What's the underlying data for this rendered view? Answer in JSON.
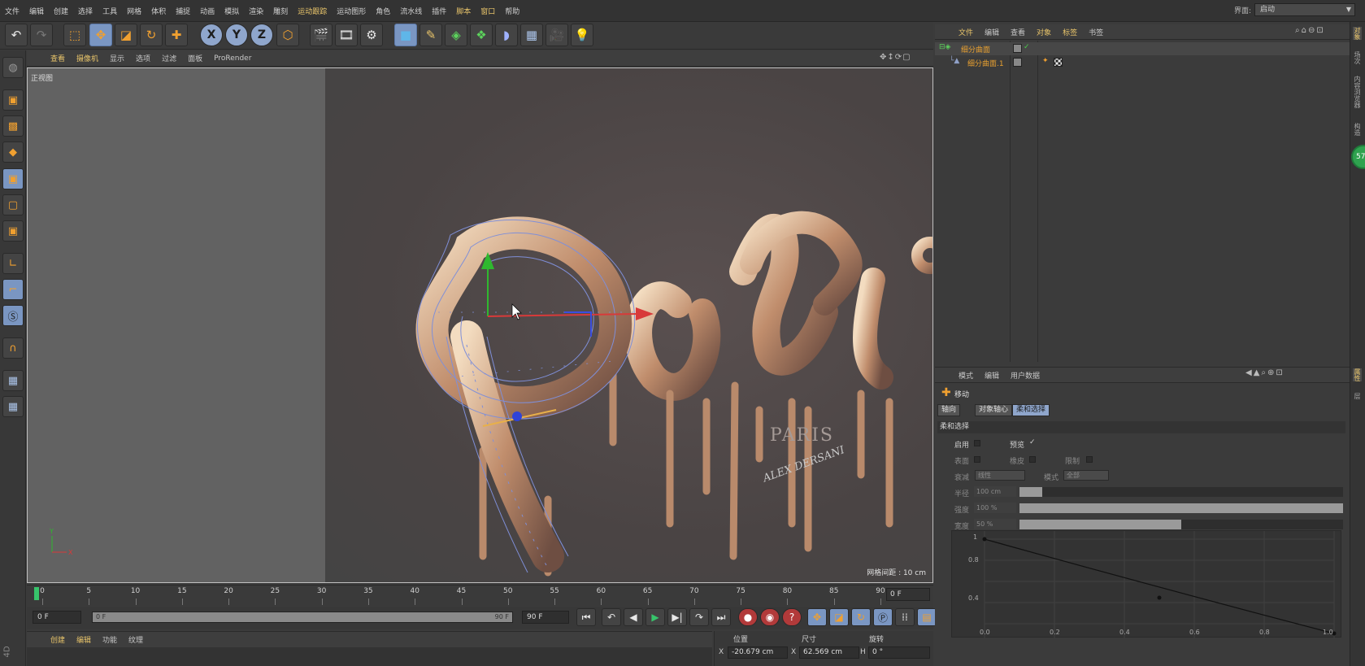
{
  "menubar": {
    "items": [
      "文件",
      "编辑",
      "创建",
      "选择",
      "工具",
      "网格",
      "体积",
      "捕捉",
      "动画",
      "模拟",
      "渲染",
      "雕刻",
      "运动跟踪",
      "运动图形",
      "角色",
      "流水线",
      "插件",
      "脚本",
      "窗口",
      "帮助"
    ],
    "highlighted": [
      "运动跟踪",
      "脚本",
      "窗口"
    ],
    "layout_label": "界面:",
    "layout_value": "启动"
  },
  "viewport": {
    "menu": [
      "查看",
      "摄像机",
      "显示",
      "选项",
      "过滤",
      "面板",
      "ProRender"
    ],
    "highlighted": [
      "查看",
      "摄像机"
    ],
    "view_name": "正视图",
    "grid_spacing": "网格间距 : 10 cm",
    "photo_text": "PARIS",
    "photo_signature": "ALEX DERSANI"
  },
  "timeline": {
    "ticks": [
      0,
      5,
      10,
      15,
      20,
      25,
      30,
      35,
      40,
      45,
      50,
      55,
      60,
      65,
      70,
      75,
      80,
      85,
      90
    ],
    "current_frame": "0 F",
    "start_field": "0 F",
    "range_start": "0 F",
    "range_end": "90 F",
    "end_field": "90 F"
  },
  "material_manager": {
    "menu": [
      "创建",
      "编辑",
      "功能",
      "纹理"
    ],
    "highlighted": [
      "创建",
      "编辑"
    ]
  },
  "coordinates": {
    "headers": [
      "位置",
      "尺寸",
      "旋转"
    ],
    "x_label": "X",
    "x_position": "-20.679 cm",
    "size_x_label": "X",
    "x_size": "62.569 cm",
    "h_label": "H",
    "rotation_h": "0 °"
  },
  "object_manager": {
    "menu": [
      "文件",
      "编辑",
      "查看",
      "对象",
      "标签",
      "书签"
    ],
    "highlighted": [
      "文件",
      "对象",
      "标签"
    ],
    "objects": [
      {
        "name": "细分曲面"
      },
      {
        "name": "细分曲面.1"
      }
    ]
  },
  "right_tabs": [
    "对象",
    "场次",
    "内容浏览器",
    "构造",
    "属性",
    "层"
  ],
  "badge": "57",
  "attribute_manager": {
    "menu": [
      "模式",
      "编辑",
      "用户数据"
    ],
    "tool_name": "移动",
    "tabs": [
      "轴向",
      "对象轴心",
      "柔和选择"
    ],
    "active_tab": "柔和选择",
    "section": "柔和选择",
    "enable_label": "启用",
    "preview_label": "预览",
    "preview_check": "✓",
    "surface_label": "表面",
    "rubber_label": "橡皮",
    "restrict_label": "限制",
    "falloff_label": "衰减",
    "falloff_value": "线性",
    "mode_label": "模式",
    "mode_value": "全部",
    "radius_label": "半径",
    "radius_value": "100 cm",
    "radius_level": 0.07,
    "strength_label": "强度",
    "strength_value": "100 %",
    "strength_level": 1.0,
    "width_label": "宽度",
    "width_value": "50 %",
    "width_level": 0.5,
    "graph_y_ticks": [
      "1",
      "0.8",
      "0.4"
    ],
    "graph_x_ticks": [
      "0.0",
      "0.2",
      "0.4",
      "0.6",
      "0.8",
      "1.0"
    ]
  },
  "colors": {
    "accent": "#e8c46a",
    "active_blue": "#7a96c2",
    "object_orange": "#e8a030",
    "timeline_marker": "#37c46b"
  },
  "icons": [
    "undo-icon",
    "redo-icon",
    "live-select-icon",
    "move-icon",
    "scale-icon",
    "rotate-icon",
    "add-icon",
    "x-axis-icon",
    "y-axis-icon",
    "z-axis-icon",
    "coordinate-system-icon",
    "render-view-icon",
    "render-picture-queue-icon",
    "render-settings-icon",
    "cube-icon",
    "pen-icon",
    "subdivision-icon",
    "array-icon",
    "deformer-icon",
    "floor-icon",
    "camera-icon",
    "light-icon"
  ]
}
